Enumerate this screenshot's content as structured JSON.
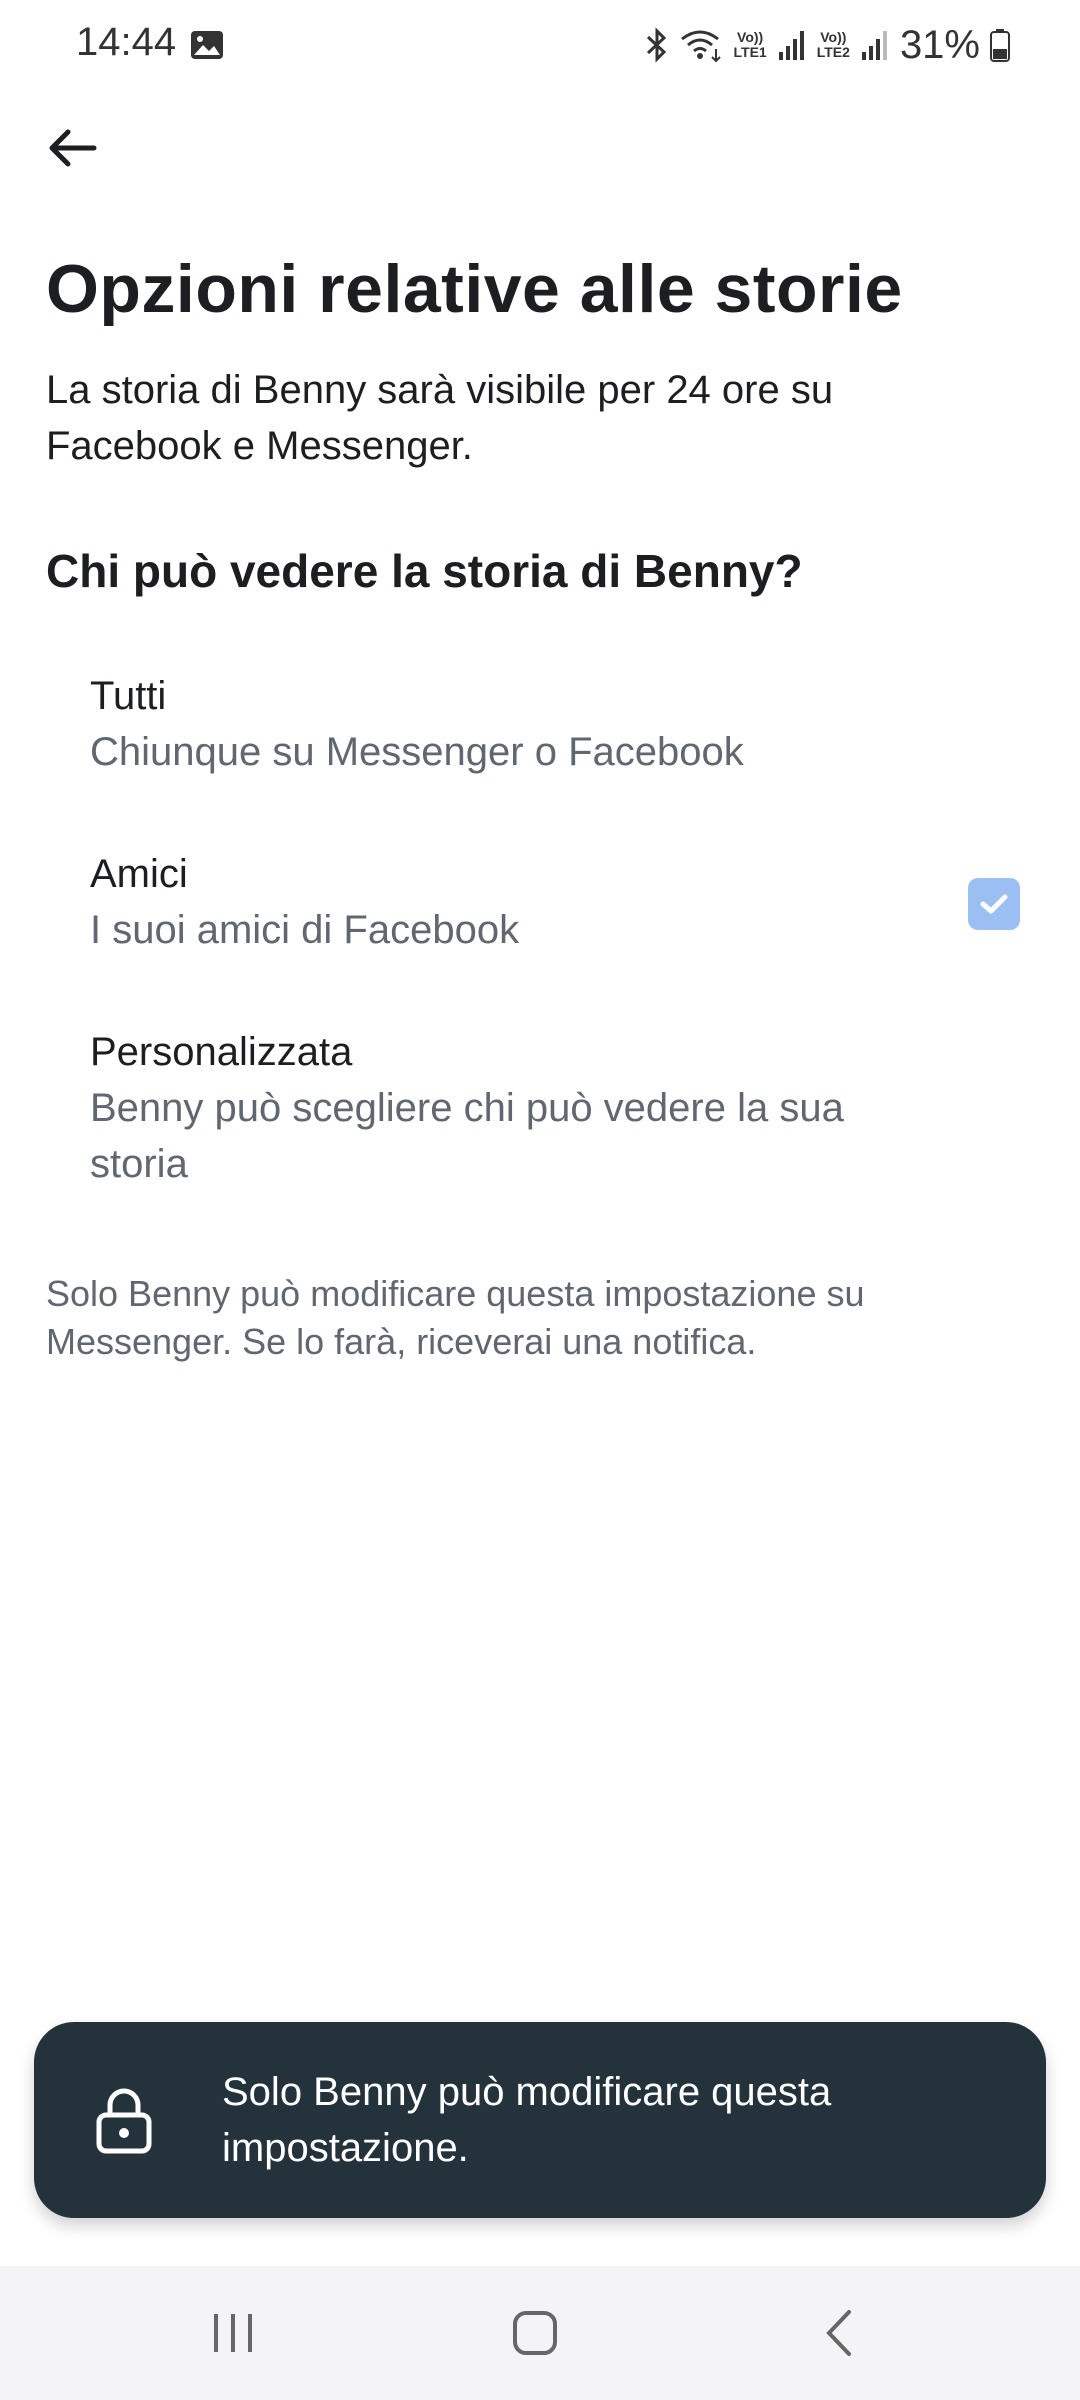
{
  "status_bar": {
    "time": "14:44",
    "lte1": "LTE1",
    "lte2": "LTE2",
    "volte": "Vo))",
    "battery": "31%"
  },
  "header": {
    "title": "Opzioni relative alle storie",
    "subtitle": "La storia di Benny sarà visibile per 24 ore su Facebook e Messenger."
  },
  "section": {
    "heading": "Chi può vedere la storia di Benny?"
  },
  "options": [
    {
      "title": "Tutti",
      "description": "Chiunque su Messenger o Facebook",
      "selected": false
    },
    {
      "title": "Amici",
      "description": "I suoi amici di Facebook",
      "selected": true
    },
    {
      "title": "Personalizzata",
      "description": "Benny può scegliere chi può vedere la sua storia",
      "selected": false
    }
  ],
  "footnote": "Solo Benny può modificare questa impostazione su Messenger. Se lo farà, riceverai una notifica.",
  "toast": {
    "message": "Solo Benny può modificare questa impostazione.",
    "icon": "lock-icon"
  },
  "colors": {
    "checkbox": "#9bbff2",
    "toast_bg": "#24323b",
    "secondary_text": "#606770"
  },
  "icons": {
    "back": "arrow-left-icon",
    "recents": "recents-icon",
    "home": "home-icon",
    "nav_back": "chevron-left-icon"
  }
}
